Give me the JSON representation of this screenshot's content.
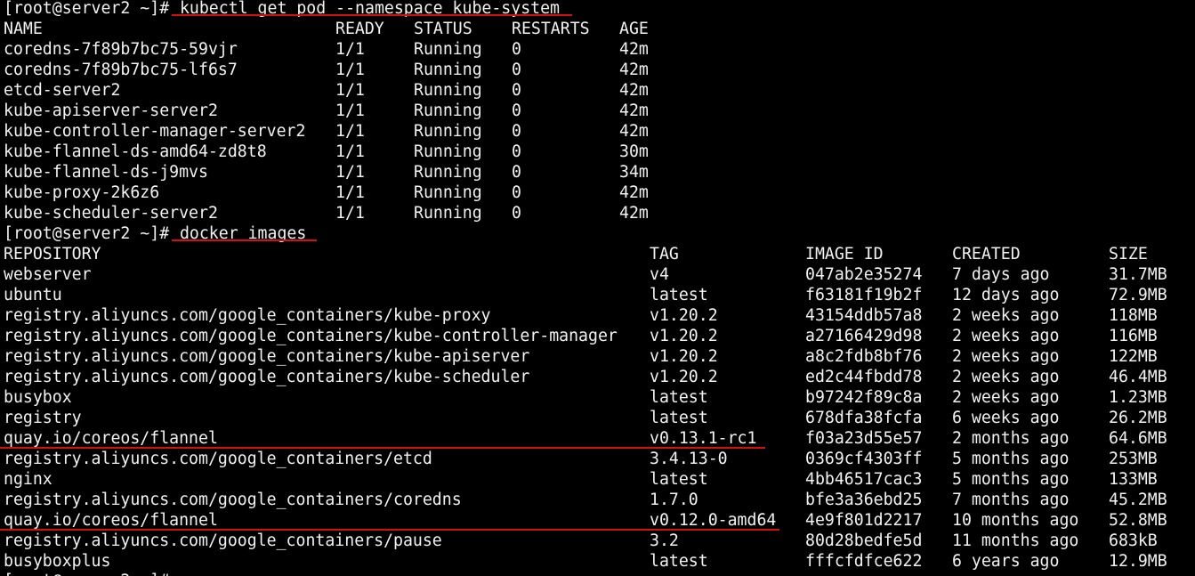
{
  "theme": {
    "background": "#000000",
    "foreground": "#f2f2f2",
    "annotation_color": "#d41010"
  },
  "prompt": "[root@server2 ~]#",
  "commands": {
    "get_pod": " kubectl get pod --namespace kube-system",
    "docker_images": " docker images"
  },
  "pods": {
    "headers": [
      "NAME",
      "READY",
      "STATUS",
      "RESTARTS",
      "AGE"
    ],
    "rows": [
      [
        "coredns-7f89b7bc75-59vjr",
        "1/1",
        "Running",
        "0",
        "42m"
      ],
      [
        "coredns-7f89b7bc75-lf6s7",
        "1/1",
        "Running",
        "0",
        "42m"
      ],
      [
        "etcd-server2",
        "1/1",
        "Running",
        "0",
        "42m"
      ],
      [
        "kube-apiserver-server2",
        "1/1",
        "Running",
        "0",
        "42m"
      ],
      [
        "kube-controller-manager-server2",
        "1/1",
        "Running",
        "0",
        "42m"
      ],
      [
        "kube-flannel-ds-amd64-zd8t8",
        "1/1",
        "Running",
        "0",
        "30m"
      ],
      [
        "kube-flannel-ds-j9mvs",
        "1/1",
        "Running",
        "0",
        "34m"
      ],
      [
        "kube-proxy-2k6z6",
        "1/1",
        "Running",
        "0",
        "42m"
      ],
      [
        "kube-scheduler-server2",
        "1/1",
        "Running",
        "0",
        "42m"
      ]
    ]
  },
  "images": {
    "headers": [
      "REPOSITORY",
      "TAG",
      "IMAGE ID",
      "CREATED",
      "SIZE"
    ],
    "rows": [
      [
        "webserver",
        "v4",
        "047ab2e35274",
        "7 days ago",
        "31.7MB"
      ],
      [
        "ubuntu",
        "latest",
        "f63181f19b2f",
        "12 days ago",
        "72.9MB"
      ],
      [
        "registry.aliyuncs.com/google_containers/kube-proxy",
        "v1.20.2",
        "43154ddb57a8",
        "2 weeks ago",
        "118MB"
      ],
      [
        "registry.aliyuncs.com/google_containers/kube-controller-manager",
        "v1.20.2",
        "a27166429d98",
        "2 weeks ago",
        "116MB"
      ],
      [
        "registry.aliyuncs.com/google_containers/kube-apiserver",
        "v1.20.2",
        "a8c2fdb8bf76",
        "2 weeks ago",
        "122MB"
      ],
      [
        "registry.aliyuncs.com/google_containers/kube-scheduler",
        "v1.20.2",
        "ed2c44fbdd78",
        "2 weeks ago",
        "46.4MB"
      ],
      [
        "busybox",
        "latest",
        "b97242f89c8a",
        "2 weeks ago",
        "1.23MB"
      ],
      [
        "registry",
        "latest",
        "678dfa38fcfa",
        "6 weeks ago",
        "26.2MB"
      ],
      [
        "quay.io/coreos/flannel",
        "v0.13.1-rc1",
        "f03a23d55e57",
        "2 months ago",
        "64.6MB"
      ],
      [
        "registry.aliyuncs.com/google_containers/etcd",
        "3.4.13-0",
        "0369cf4303ff",
        "5 months ago",
        "253MB"
      ],
      [
        "nginx",
        "latest",
        "4bb46517cac3",
        "5 months ago",
        "133MB"
      ],
      [
        "registry.aliyuncs.com/google_containers/coredns",
        "1.7.0",
        "bfe3a36ebd25",
        "7 months ago",
        "45.2MB"
      ],
      [
        "quay.io/coreos/flannel",
        "v0.12.0-amd64",
        "4e9f801d2217",
        "10 months ago",
        "52.8MB"
      ],
      [
        "registry.aliyuncs.com/google_containers/pause",
        "3.2",
        "80d28bedfe5d",
        "11 months ago",
        "683kB"
      ],
      [
        "busyboxplus",
        "latest",
        "fffcfdfce622",
        "6 years ago",
        "12.9MB"
      ]
    ]
  }
}
